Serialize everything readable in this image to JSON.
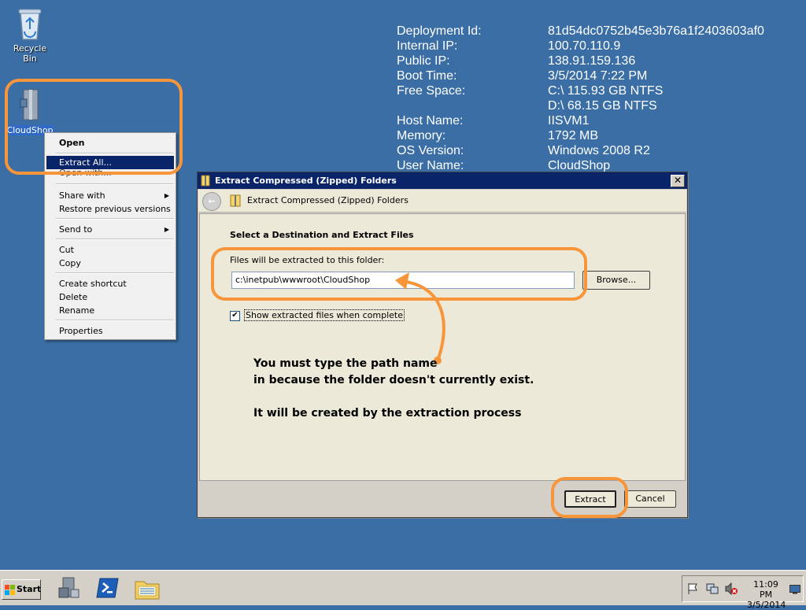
{
  "desktop": {
    "recycle_bin": "Recycle Bin",
    "cloudshop": "CloudShop"
  },
  "bginfo": [
    {
      "key": "Deployment Id:",
      "value": "81d54dc0752b45e3b76a1f2403603af0"
    },
    {
      "key": "Internal IP:",
      "value": "100.70.110.9"
    },
    {
      "key": "Public IP:",
      "value": "138.91.159.136"
    },
    {
      "key": "Boot Time:",
      "value": "3/5/2014 7:22 PM"
    },
    {
      "key": "Free Space:",
      "value": "C:\\ 115.93 GB NTFS"
    },
    {
      "key": "",
      "value": "D:\\ 68.15 GB NTFS"
    },
    {
      "key": "",
      "value": ""
    },
    {
      "key": "Host Name:",
      "value": "IISVM1"
    },
    {
      "key": "Memory:",
      "value": "1792 MB"
    },
    {
      "key": "OS Version:",
      "value": "Windows 2008 R2"
    },
    {
      "key": "User Name:",
      "value": "CloudShop"
    }
  ],
  "context_menu": {
    "open": "Open",
    "extract_all": "Extract All...",
    "open_with": "Open with...",
    "share_with": "Share with",
    "restore": "Restore previous versions",
    "send_to": "Send to",
    "cut": "Cut",
    "copy": "Copy",
    "create_shortcut": "Create shortcut",
    "delete": "Delete",
    "rename": "Rename",
    "properties": "Properties"
  },
  "dialog": {
    "window_title": "Extract Compressed (Zipped) Folders",
    "header_title": "Extract Compressed (Zipped) Folders",
    "section_title": "Select a Destination and Extract Files",
    "folder_label": "Files will be extracted to this folder:",
    "folder_value": "c:\\inetpub\\wwwroot\\CloudShop",
    "browse": "Browse...",
    "show_files_label": "Show extracted files when complete",
    "show_files_checked": true,
    "extract": "Extract",
    "cancel": "Cancel"
  },
  "annotation": {
    "line1": "You must type the path name",
    "line2": "in because the folder doesn't currently exist.",
    "line3": "It will be created by the extraction process"
  },
  "taskbar": {
    "start": "Start",
    "time": "11:09 PM",
    "date": "3/5/2014"
  },
  "colors": {
    "desktop": "#3a6ea5",
    "callout": "#f7953a",
    "highlight": "#0a246a"
  }
}
